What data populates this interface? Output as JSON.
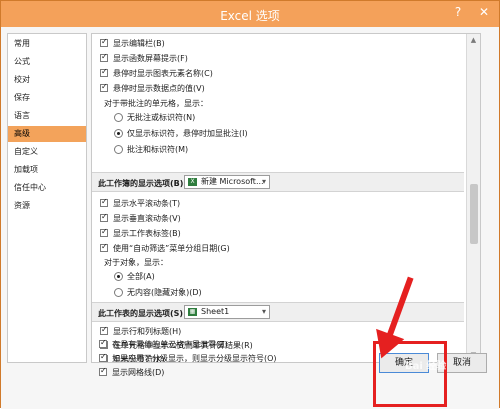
{
  "window": {
    "title": "Excel 选项",
    "help_label": "?",
    "close_label": "✕"
  },
  "sidebar": {
    "items": [
      {
        "label": "常用"
      },
      {
        "label": "公式"
      },
      {
        "label": "校对"
      },
      {
        "label": "保存"
      },
      {
        "label": "语言"
      },
      {
        "label": "高级",
        "active": true
      },
      {
        "label": "自定义"
      },
      {
        "label": "加载项"
      },
      {
        "label": "信任中心"
      },
      {
        "label": "资源"
      }
    ]
  },
  "content": {
    "top_options": [
      {
        "label": "显示编辑栏(B)",
        "checked": true
      },
      {
        "label": "显示函数屏幕提示(F)",
        "checked": true
      },
      {
        "label": "悬停时显示图表元素名称(C)",
        "checked": true
      },
      {
        "label": "悬停时显示数据点的值(V)",
        "checked": true
      }
    ],
    "comment_label": "对于带批注的单元格，显示：",
    "comment_options": [
      {
        "label": "无批注或标识符(N)",
        "checked": false
      },
      {
        "label": "仅显示标识符，悬停时加显批注(I)",
        "checked": true
      },
      {
        "label": "批注和标识符(M)",
        "checked": false
      }
    ],
    "workbook_section": {
      "title": "此工作簿的显示选项(B):",
      "select_value": "新建 Microsoft...",
      "options": [
        {
          "label": "显示水平滚动条(T)",
          "checked": true
        },
        {
          "label": "显示垂直滚动条(V)",
          "checked": true
        },
        {
          "label": "显示工作表标签(B)",
          "checked": true
        },
        {
          "label": "使用“自动筛选”菜单分组日期(G)",
          "checked": true
        }
      ],
      "objects_label": "对于对象，显示：",
      "object_options": [
        {
          "label": "全部(A)",
          "checked": true
        },
        {
          "label": "无内容(隐藏对象)(D)",
          "checked": false
        }
      ]
    },
    "sheet_section": {
      "title": "此工作表的显示选项(S):",
      "select_value": "Sheet1",
      "options": [
        {
          "label": "显示行和列标题(H)",
          "checked": true
        },
        {
          "label": "在单元格中显示公式而非其计算结果(R)",
          "checked": false
        },
        {
          "label": "显示分页符(K)",
          "checked": false
        },
        {
          "label": "在具有零值的单元格中显示零(Z)",
          "checked": true
        },
        {
          "label": "如果应用了分级显示，则显示分级显示符号(O)",
          "checked": true
        },
        {
          "label": "显示网格线(D)",
          "checked": true
        }
      ]
    }
  },
  "footer": {
    "ok_label": "确定",
    "cancel_label": "取消"
  },
  "watermark": "Bai 经验",
  "colors": {
    "titlebar": "#f4a15a",
    "active_nav": "#f3a35b",
    "highlight": "#e52020"
  }
}
